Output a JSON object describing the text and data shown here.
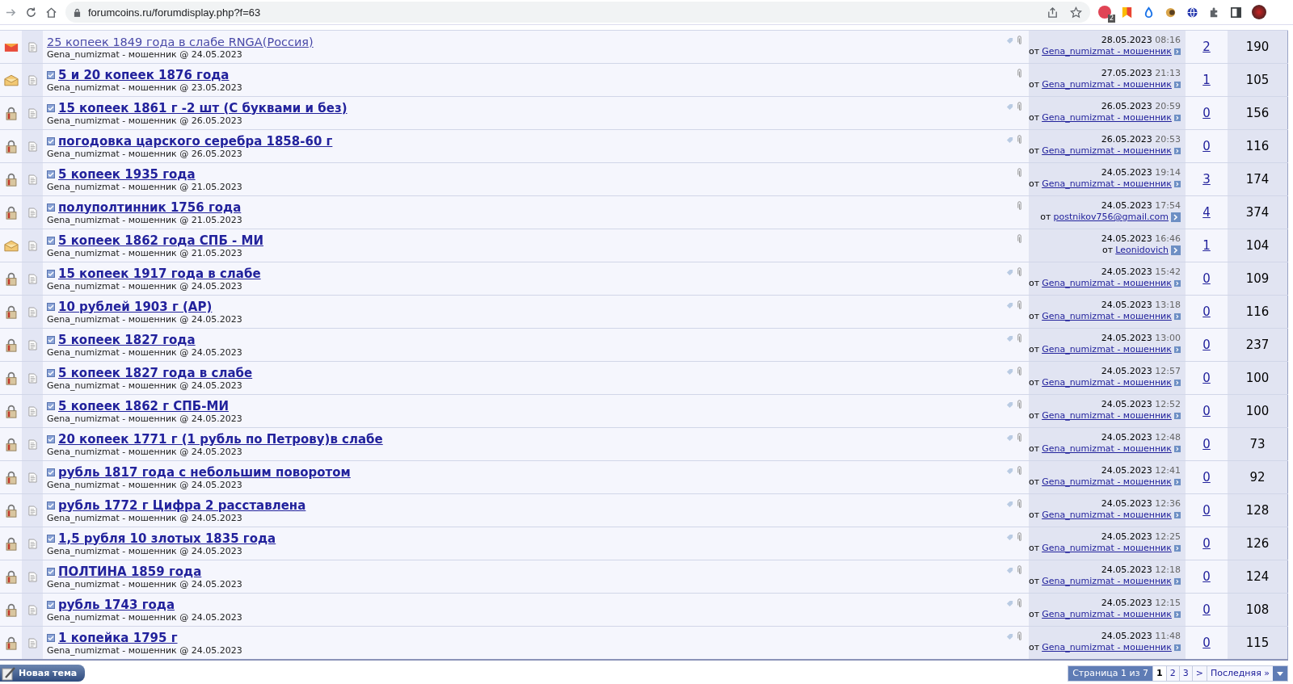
{
  "browser": {
    "url": "forumcoins.ru/forumdisplay.php?f=63",
    "extension_badge": "2"
  },
  "threads": [
    {
      "kind": "hot",
      "unread": false,
      "title": "25 копеек 1849 года в слабе RNGA(Россия)",
      "starter": "Gena_numizmat - мошенник @ 24.05.2023",
      "tagged": true,
      "last_date": "28.05.2023",
      "last_time": "08:16",
      "last_prefix": "от",
      "last_author": "Gena_numizmat - мошенник",
      "replies": "2",
      "views": "190"
    },
    {
      "kind": "new",
      "unread": true,
      "title": "5 и 20 копеек 1876 года",
      "starter": "Gena_numizmat - мошенник @ 23.05.2023",
      "tagged": false,
      "last_date": "27.05.2023",
      "last_time": "21:13",
      "last_prefix": "от",
      "last_author": "Gena_numizmat - мошенник",
      "replies": "1",
      "views": "105"
    },
    {
      "kind": "locked",
      "unread": true,
      "title": "15 копеек 1861 г -2 шт (С буквами и без)",
      "starter": "Gena_numizmat - мошенник @ 26.05.2023",
      "tagged": true,
      "last_date": "26.05.2023",
      "last_time": "20:59",
      "last_prefix": "от",
      "last_author": "Gena_numizmat - мошенник",
      "replies": "0",
      "views": "156"
    },
    {
      "kind": "locked",
      "unread": true,
      "title": "погодовка царского серебра 1858-60 г",
      "starter": "Gena_numizmat - мошенник @ 26.05.2023",
      "tagged": true,
      "last_date": "26.05.2023",
      "last_time": "20:53",
      "last_prefix": "от",
      "last_author": "Gena_numizmat - мошенник",
      "replies": "0",
      "views": "116"
    },
    {
      "kind": "locked",
      "unread": true,
      "title": "5 копеек 1935 года",
      "starter": "Gena_numizmat - мошенник @ 21.05.2023",
      "tagged": false,
      "last_date": "24.05.2023",
      "last_time": "19:14",
      "last_prefix": "от",
      "last_author": "Gena_numizmat - мошенник",
      "replies": "3",
      "views": "174"
    },
    {
      "kind": "locked",
      "unread": true,
      "title": "полуполтинник 1756 года",
      "starter": "Gena_numizmat - мошенник @ 21.05.2023",
      "tagged": false,
      "last_date": "24.05.2023",
      "last_time": "17:54",
      "last_prefix": "от",
      "last_author": "postnikov756@gmail.com",
      "replies": "4",
      "views": "374"
    },
    {
      "kind": "new",
      "unread": true,
      "title": "5 копеек 1862 года СПБ - МИ",
      "starter": "Gena_numizmat - мошенник @ 21.05.2023",
      "tagged": false,
      "last_date": "24.05.2023",
      "last_time": "16:46",
      "last_prefix": "от",
      "last_author": "Leonidovich",
      "replies": "1",
      "views": "104"
    },
    {
      "kind": "locked",
      "unread": true,
      "title": "15 копеек 1917 года в слабе",
      "starter": "Gena_numizmat - мошенник @ 24.05.2023",
      "tagged": true,
      "last_date": "24.05.2023",
      "last_time": "15:42",
      "last_prefix": "от",
      "last_author": "Gena_numizmat - мошенник",
      "replies": "0",
      "views": "109"
    },
    {
      "kind": "locked",
      "unread": true,
      "title": "10 рублей 1903 г (АР)",
      "starter": "Gena_numizmat - мошенник @ 24.05.2023",
      "tagged": true,
      "last_date": "24.05.2023",
      "last_time": "13:18",
      "last_prefix": "от",
      "last_author": "Gena_numizmat - мошенник",
      "replies": "0",
      "views": "116"
    },
    {
      "kind": "locked",
      "unread": true,
      "title": "5 копеек 1827 года",
      "starter": "Gena_numizmat - мошенник @ 24.05.2023",
      "tagged": true,
      "last_date": "24.05.2023",
      "last_time": "13:00",
      "last_prefix": "от",
      "last_author": "Gena_numizmat - мошенник",
      "replies": "0",
      "views": "237"
    },
    {
      "kind": "locked",
      "unread": true,
      "title": "5 копеек 1827 года в слабе",
      "starter": "Gena_numizmat - мошенник @ 24.05.2023",
      "tagged": true,
      "last_date": "24.05.2023",
      "last_time": "12:57",
      "last_prefix": "от",
      "last_author": "Gena_numizmat - мошенник",
      "replies": "0",
      "views": "100"
    },
    {
      "kind": "locked",
      "unread": true,
      "title": "5 копеек 1862 г СПБ-МИ",
      "starter": "Gena_numizmat - мошенник @ 24.05.2023",
      "tagged": true,
      "last_date": "24.05.2023",
      "last_time": "12:52",
      "last_prefix": "от",
      "last_author": "Gena_numizmat - мошенник",
      "replies": "0",
      "views": "100"
    },
    {
      "kind": "locked",
      "unread": true,
      "title": "20 копеек 1771 г (1 рубль по Петрову)в слабе",
      "starter": "Gena_numizmat - мошенник @ 24.05.2023",
      "tagged": true,
      "last_date": "24.05.2023",
      "last_time": "12:48",
      "last_prefix": "от",
      "last_author": "Gena_numizmat - мошенник",
      "replies": "0",
      "views": "73"
    },
    {
      "kind": "locked",
      "unread": true,
      "title": "рубль 1817 года с небольшим поворотом",
      "starter": "Gena_numizmat - мошенник @ 24.05.2023",
      "tagged": true,
      "last_date": "24.05.2023",
      "last_time": "12:41",
      "last_prefix": "от",
      "last_author": "Gena_numizmat - мошенник",
      "replies": "0",
      "views": "92"
    },
    {
      "kind": "locked",
      "unread": true,
      "title": "рубль 1772 г Цифра 2 расставлена",
      "starter": "Gena_numizmat - мошенник @ 24.05.2023",
      "tagged": true,
      "last_date": "24.05.2023",
      "last_time": "12:36",
      "last_prefix": "от",
      "last_author": "Gena_numizmat - мошенник",
      "replies": "0",
      "views": "128"
    },
    {
      "kind": "locked",
      "unread": true,
      "title": "1,5 рубля 10 злотых 1835 года",
      "starter": "Gena_numizmat - мошенник @ 24.05.2023",
      "tagged": true,
      "last_date": "24.05.2023",
      "last_time": "12:25",
      "last_prefix": "от",
      "last_author": "Gena_numizmat - мошенник",
      "replies": "0",
      "views": "126"
    },
    {
      "kind": "locked",
      "unread": true,
      "title": "ПОЛТИНА 1859 года",
      "starter": "Gena_numizmat - мошенник @ 24.05.2023",
      "tagged": true,
      "last_date": "24.05.2023",
      "last_time": "12:18",
      "last_prefix": "от",
      "last_author": "Gena_numizmat - мошенник",
      "replies": "0",
      "views": "124"
    },
    {
      "kind": "locked",
      "unread": true,
      "title": "рубль 1743 года",
      "starter": "Gena_numizmat - мошенник @ 24.05.2023",
      "tagged": true,
      "last_date": "24.05.2023",
      "last_time": "12:15",
      "last_prefix": "от",
      "last_author": "Gena_numizmat - мошенник",
      "replies": "0",
      "views": "108"
    },
    {
      "kind": "locked",
      "unread": true,
      "title": "1 копейка 1795 г",
      "starter": "Gena_numizmat - мошенник @ 24.05.2023",
      "tagged": true,
      "last_date": "24.05.2023",
      "last_time": "11:48",
      "last_prefix": "от",
      "last_author": "Gena_numizmat - мошенник",
      "replies": "0",
      "views": "115"
    }
  ],
  "new_thread_button": "Новая тема",
  "pagination": {
    "label": "Страница 1 из 7",
    "pages": [
      {
        "label": "1",
        "selected": true
      },
      {
        "label": "2",
        "selected": false
      },
      {
        "label": "3",
        "selected": false
      }
    ],
    "next": ">",
    "last": "Последняя »"
  }
}
